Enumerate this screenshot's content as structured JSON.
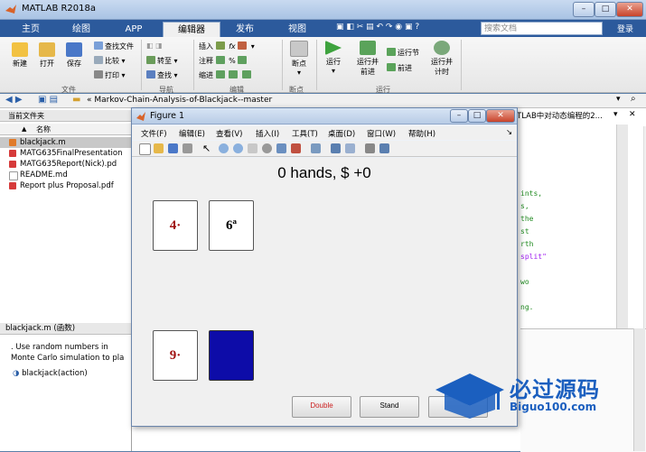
{
  "window": {
    "title": "MATLAB R2018a"
  },
  "tabs": [
    {
      "label": "主页"
    },
    {
      "label": "绘图"
    },
    {
      "label": "APP"
    },
    {
      "label": "编辑器"
    },
    {
      "label": "发布"
    },
    {
      "label": "视图"
    }
  ],
  "search": {
    "placeholder": "搜索文档"
  },
  "login_label": "登录",
  "ribbon": {
    "file": {
      "new": "新建",
      "open": "打开",
      "save": "保存",
      "find_files": "查找文件",
      "compare": "比较",
      "print": "打印",
      "group": "文件"
    },
    "nav": {
      "goto": "转至",
      "find": "查找",
      "group": "导航"
    },
    "edit": {
      "insert": "插入",
      "comment": "注释",
      "indent": "缩进",
      "group": "编辑"
    },
    "breakpoints": {
      "bp": "断点",
      "group": "断点"
    },
    "run": {
      "run": "运行",
      "run_advance": "运行并\n前进",
      "run_section": "运行节",
      "advance": "前进",
      "run_time": "运行并\n计时",
      "group": "运行"
    }
  },
  "address": {
    "path": "«  Markov-Chain-Analysis-of-Blackjack--master"
  },
  "current_folder": {
    "title": "当前文件夹",
    "column": "名称",
    "sort_arrow": "▲",
    "files": [
      "blackjack.m",
      "MATG635FinalPresentation",
      "MATG635Report(Nick).pd",
      "README.md",
      "Report plus Proposal.pdf"
    ]
  },
  "details": {
    "header": "blackjack.m  (函数)",
    "line1": ".  Use random numbers in",
    "line2": "Monte Carlo simulation to pla",
    "func": "blackjack(action)"
  },
  "editor": {
    "header_text": "TLAB中对动态编程的2...",
    "code_lines": [
      "ints,",
      "s,",
      "the",
      "st",
      "rth",
      "split\"",
      "wo",
      "ng."
    ]
  },
  "figure": {
    "title": "Figure 1",
    "menu": [
      "文件(F)",
      "编辑(E)",
      "查看(V)",
      "插入(I)",
      "工具(T)",
      "桌面(D)",
      "窗口(W)",
      "帮助(H)"
    ],
    "status": "0 hands,  $ +0",
    "dealer_cards": [
      {
        "label": "4·"
      },
      {
        "label": "6ª"
      }
    ],
    "player_cards": [
      {
        "label": "9·"
      }
    ],
    "buttons": {
      "double": "Double",
      "stand": "Stand"
    }
  },
  "watermark": {
    "big": "必过源码",
    "small": "Biguo100.com"
  },
  "colors": {
    "tab_bar": "#2c5a9c",
    "card_red": "#a01010",
    "card_back": "#0d0ca8",
    "double_text": "#cc2020"
  }
}
